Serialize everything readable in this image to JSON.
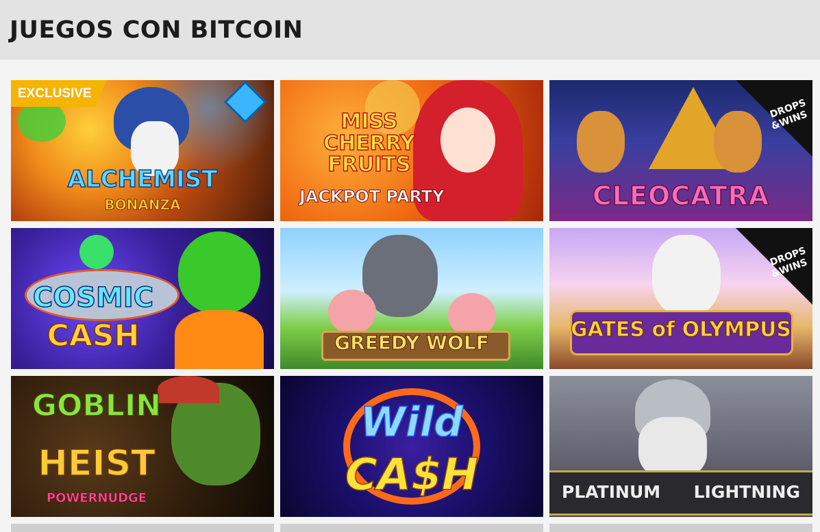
{
  "page": {
    "title": "JUEGOS CON BITCOIN"
  },
  "badges": {
    "exclusive": "EXCLUSIVE",
    "drops_line1": "DROPS",
    "drops_line2": "&WINS"
  },
  "games": [
    {
      "id": "alchemist-bonanza",
      "title": "ALCHEMIST",
      "subtitle": "BONANZA",
      "badge": "exclusive"
    },
    {
      "id": "miss-cherry-fruits",
      "title": "MISS CHERRY FRUITS",
      "subtitle": "JACKPOT PARTY",
      "badge": null
    },
    {
      "id": "cleocatra",
      "title": "CLEOCATRA",
      "subtitle": "",
      "badge": "drops-wins"
    },
    {
      "id": "cosmic-cash",
      "title": "COSMIC",
      "subtitle": "CASH",
      "badge": null
    },
    {
      "id": "greedy-wolf",
      "title": "GREEDY WOLF",
      "subtitle": "",
      "badge": null
    },
    {
      "id": "gates-of-olympus",
      "title": "GATES of OLYMPUS",
      "subtitle": "",
      "badge": "drops-wins"
    },
    {
      "id": "goblin-heist",
      "title": "GOBLIN",
      "subtitle": "HEIST",
      "extra": "POWERNUDGE",
      "badge": null
    },
    {
      "id": "wild-cash",
      "title": "Wild",
      "subtitle": "CA$H",
      "badge": null
    },
    {
      "id": "platinum-lightning",
      "title": "PLATINUM",
      "subtitle": "LIGHTNING",
      "badge": null
    }
  ]
}
